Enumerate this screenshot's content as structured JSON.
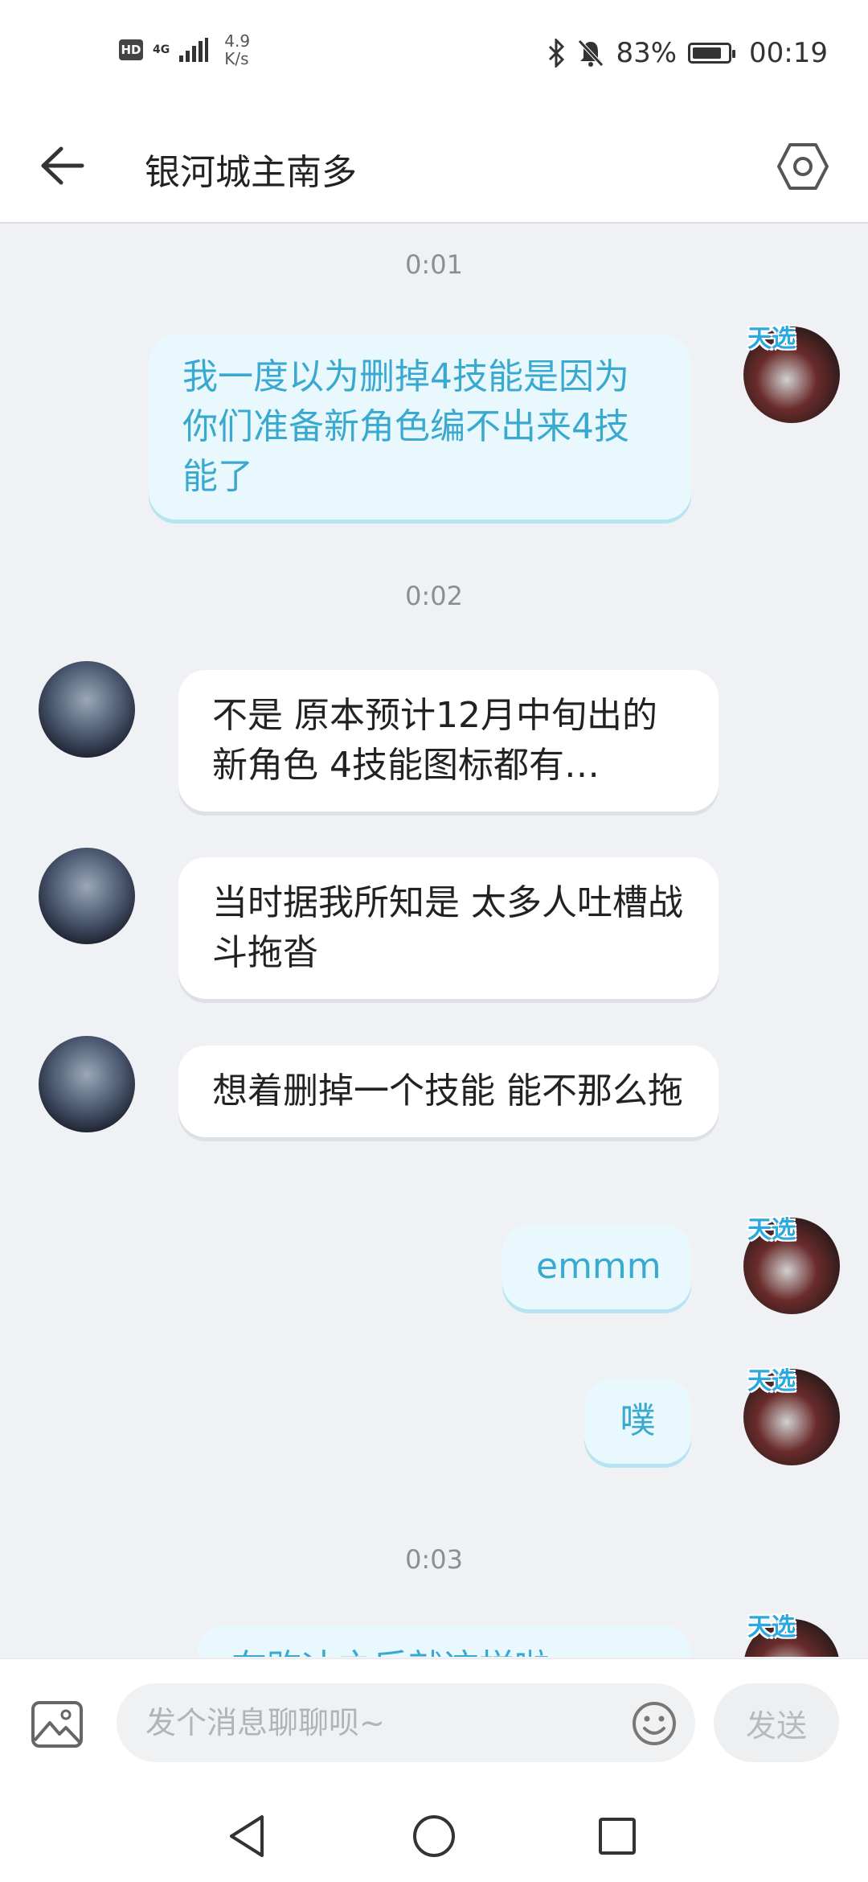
{
  "status_bar": {
    "hd_label": "HD",
    "network_type": "4G",
    "net_speed_value": "4.9",
    "net_speed_unit": "K/s",
    "battery": "83%",
    "battery_level": 0.83,
    "time": "00:19",
    "icons": [
      "bluetooth-icon",
      "mute-bell-icon",
      "battery-icon",
      "signal-icon"
    ]
  },
  "header": {
    "title": "银河城主南多",
    "back_icon": "arrow-left-icon",
    "settings_icon": "settings-hexagon-icon"
  },
  "chat": {
    "timestamps": [
      "0:01",
      "0:02",
      "0:03"
    ],
    "messages": [
      {
        "from": "me",
        "text": "我一度以为删掉4技能是因为你们准备新角色编不出来4技能了"
      },
      {
        "from": "other",
        "text": "不是 原本预计12月中旬出的新角色 4技能图标都有…"
      },
      {
        "from": "other",
        "text": "当时据我所知是 太多人吐槽战斗拖沓"
      },
      {
        "from": "other",
        "text": "想着删掉一个技能 能不那么拖"
      },
      {
        "from": "me",
        "text": "emmm"
      },
      {
        "from": "me",
        "text": "噗"
      },
      {
        "from": "me",
        "text": "在购冰之后就这样啦"
      }
    ],
    "sticker_text": "天选"
  },
  "input_bar": {
    "placeholder": "发个消息聊聊呗~",
    "send_label": "发送",
    "image_icon": "image-icon",
    "emoji_icon": "emoji-icon"
  },
  "nav_bar": {
    "icons": [
      "nav-back-icon",
      "nav-home-icon",
      "nav-recents-icon"
    ]
  },
  "colors": {
    "background": "#eff1f4",
    "outgoing_bubble": "#e9f8fd",
    "outgoing_text": "#3aa9d0",
    "incoming_bubble": "#ffffff"
  }
}
